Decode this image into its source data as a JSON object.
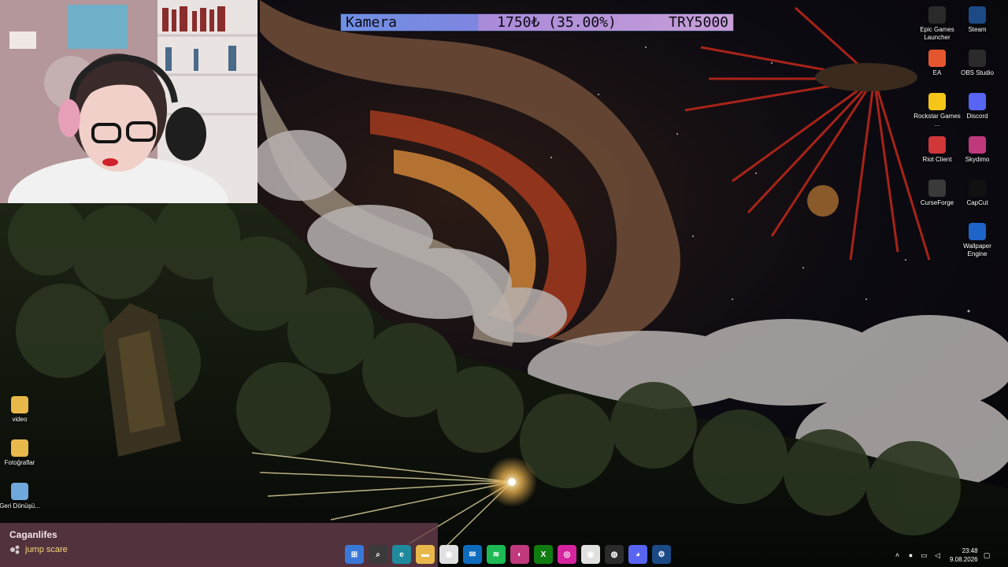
{
  "stream": {
    "goal": {
      "title": "Kamera",
      "progress_text": "1750₺ (35.00%)",
      "target": "TRY5000",
      "progress_fraction": 0.35
    },
    "chat": {
      "username": "Caganlifes",
      "message": "jump scare"
    }
  },
  "desktop": {
    "icons_right": [
      {
        "label": "Epic Games Launcher",
        "icon": "epic-games-icon",
        "color": "#2a2a2a"
      },
      {
        "label": "Steam",
        "icon": "steam-icon",
        "color": "#1b4a86"
      },
      {
        "label": "EA",
        "icon": "ea-icon",
        "color": "#e4572e"
      },
      {
        "label": "OBS Studio",
        "icon": "obs-icon",
        "color": "#2b2b2b"
      },
      {
        "label": "Rockstar Games ...",
        "icon": "rockstar-icon",
        "color": "#f5c518"
      },
      {
        "label": "Discord",
        "icon": "discord-icon",
        "color": "#5865f2"
      },
      {
        "label": "Riot Client",
        "icon": "riot-icon",
        "color": "#d13639"
      },
      {
        "label": "Skydimo",
        "icon": "skydimo-icon",
        "color": "#c0397d"
      },
      {
        "label": "CurseForge",
        "icon": "curseforge-icon",
        "color": "#3a3a3a"
      },
      {
        "label": "CapCut",
        "icon": "capcut-icon",
        "color": "#111111"
      },
      {
        "label": "Wallpaper Engine",
        "icon": "wallpaper-engine-icon",
        "color": "#1e64c8"
      }
    ],
    "icons_left": [
      {
        "label": "video",
        "icon": "folder-icon",
        "color": "#e8b84a"
      },
      {
        "label": "Fotoğraflar",
        "icon": "folder-icon",
        "color": "#e8b84a"
      },
      {
        "label": "Geri Dönüşü...",
        "icon": "recycle-bin-icon",
        "color": "#6fa8dc"
      }
    ]
  },
  "taskbar": {
    "apps": [
      {
        "name": "start-button",
        "icon": "windows-icon",
        "color": "#3a78d8"
      },
      {
        "name": "search-button",
        "icon": "search-icon",
        "color": "#3a3a3a"
      },
      {
        "name": "edge-app",
        "icon": "edge-icon",
        "color": "#1f8a9e"
      },
      {
        "name": "file-explorer-app",
        "icon": "folder-icon",
        "color": "#e8b84a"
      },
      {
        "name": "chrome-app",
        "icon": "chrome-icon",
        "color": "#e0e0e0"
      },
      {
        "name": "mail-app",
        "icon": "mail-icon",
        "color": "#0f6cbd"
      },
      {
        "name": "spotify-app",
        "icon": "spotify-icon",
        "color": "#1db954"
      },
      {
        "name": "skydimo-app",
        "icon": "skydimo-icon",
        "color": "#c0397d"
      },
      {
        "name": "xbox-app",
        "icon": "xbox-icon",
        "color": "#107c10"
      },
      {
        "name": "instagram-app",
        "icon": "instagram-icon",
        "color": "#d6249f"
      },
      {
        "name": "chrome-profile-app",
        "icon": "chrome-icon",
        "color": "#e0e0e0"
      },
      {
        "name": "obs-app",
        "icon": "obs-icon",
        "color": "#2b2b2b"
      },
      {
        "name": "discord-app",
        "icon": "discord-icon",
        "color": "#5865f2"
      },
      {
        "name": "steam-app",
        "icon": "steam-icon",
        "color": "#1b4a86"
      }
    ],
    "clock": {
      "time": "23:48",
      "date": "9.08.2026"
    }
  }
}
